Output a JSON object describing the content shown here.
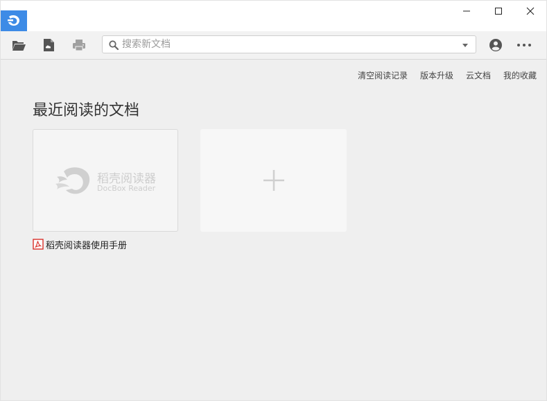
{
  "search": {
    "placeholder": "搜索新文档"
  },
  "top_links": {
    "clear_history": "清空阅读记录",
    "upgrade": "版本升级",
    "cloud_docs": "云文档",
    "favorites": "我的收藏"
  },
  "main": {
    "section_title": "最近阅读的文档",
    "recent_docs": [
      {
        "name": "稻壳阅读器使用手册",
        "thumb_cn": "稻壳阅读器",
        "thumb_en": "DocBox Reader"
      }
    ]
  },
  "colors": {
    "accent": "#3d8be6",
    "pdf_red": "#d9302a",
    "toolbar_bg": "#f2f2f2",
    "content_bg": "#efefef"
  },
  "icons": {
    "app": "app-logo-icon",
    "open": "folder-open-icon",
    "cloud": "cloud-document-icon",
    "print": "printer-icon",
    "search": "search-icon",
    "dropdown": "chevron-down-icon",
    "user": "user-icon",
    "more": "more-icon",
    "add": "plus-icon",
    "pdf": "pdf-icon"
  }
}
